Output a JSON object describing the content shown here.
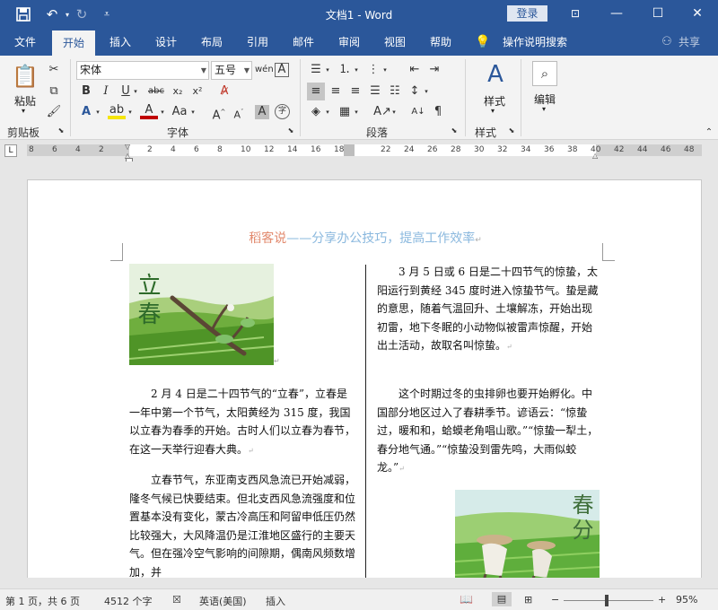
{
  "window": {
    "title": "文档1 - Word",
    "login_label": "登录"
  },
  "tabs": [
    {
      "label": "文件"
    },
    {
      "label": "开始"
    },
    {
      "label": "插入"
    },
    {
      "label": "设计"
    },
    {
      "label": "布局"
    },
    {
      "label": "引用"
    },
    {
      "label": "邮件"
    },
    {
      "label": "审阅"
    },
    {
      "label": "视图"
    },
    {
      "label": "帮助"
    },
    {
      "label": "操作说明搜索"
    },
    {
      "label": "共享"
    }
  ],
  "ribbon": {
    "clipboard": {
      "paste_label": "粘贴",
      "group_label": "剪贴板"
    },
    "font": {
      "font_name": "宋体",
      "font_size": "五号",
      "group_label": "字体"
    },
    "paragraph": {
      "group_label": "段落"
    },
    "styles": {
      "label": "样式",
      "group_label": "样式"
    },
    "editing": {
      "label": "编辑"
    }
  },
  "ruler": {
    "ticks": [
      "8",
      "6",
      "4",
      "2",
      "2",
      "4",
      "6",
      "8",
      "10",
      "12",
      "14",
      "16",
      "18",
      "22",
      "24",
      "26",
      "28",
      "30",
      "32",
      "34",
      "36",
      "38",
      "40",
      "42",
      "44",
      "46",
      "48"
    ]
  },
  "document": {
    "header": {
      "part1": "稻客说",
      "part2": "——分享办公技巧，提高工作效率"
    },
    "image_left_caption": "立春",
    "image_right_caption": "春分",
    "col1": {
      "p1": "2 月 4 日是二十四节气的“立春”，立春是一年中第一个节气，太阳黄经为 315 度，我国以立春为春季的开始。古时人们以立春为春节，在这一天举行迎春大典。",
      "p2": "立春节气，东亚南支西风急流已开始减弱，隆冬气候已快要结束。但北支西风急流强度和位置基本没有变化，蒙古冷高压和阿留申低压仍然比较强大，大风降温仍是江淮地区盛行的主要天气。但在强冷空气影响的间隙期，偶南风频数增加，并"
    },
    "col2": {
      "p1": "3 月 5 日或 6 日是二十四节气的惊蛰，太阳运行到黄经 345 度时进入惊蛰节气。蛰是藏的意思，随着气温回升、土壤解冻，开始出现初雷，地下冬眠的小动物似被雷声惊醒，开始出土活动，故取名叫惊蛰。",
      "p2": "这个时期过冬的虫排卵也要开始孵化。中国部分地区过入了春耕季节。谚语云：“惊蛰过，暖和和，蛤蟆老角唱山歌。”“惊蛰一犁土，春分地气通。”“惊蛰没到雷先鸣，大雨似蛟龙。”"
    }
  },
  "status": {
    "page": "第 1 页，共 6 页",
    "words": "4512 个字",
    "language": "英语(美国)",
    "mode": "插入",
    "zoom": "95%"
  }
}
